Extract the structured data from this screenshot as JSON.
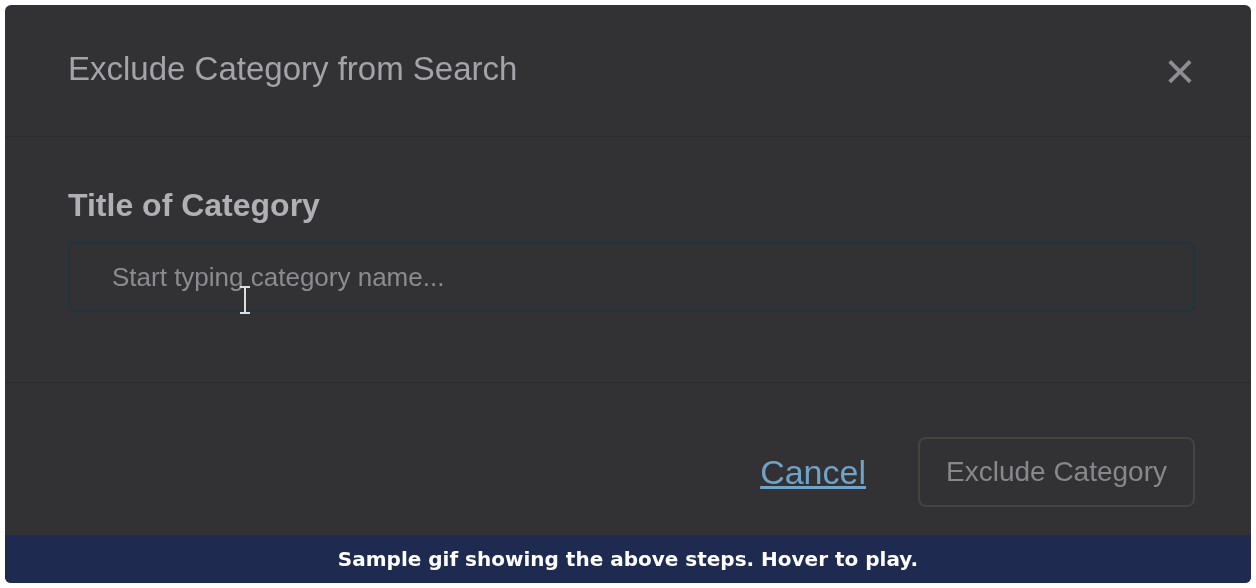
{
  "dialog": {
    "title": "Exclude Category from Search",
    "close": "×"
  },
  "field": {
    "label": "Title of Category",
    "placeholder": "Start typing category name..."
  },
  "buttons": [
    {
      "label": "Cancel",
      "kind": "link",
      "disabled": false
    },
    {
      "label": "Exclude Category",
      "kind": "button",
      "disabled": true
    }
  ],
  "caption": "Sample gif showing the above steps. Hover to play."
}
